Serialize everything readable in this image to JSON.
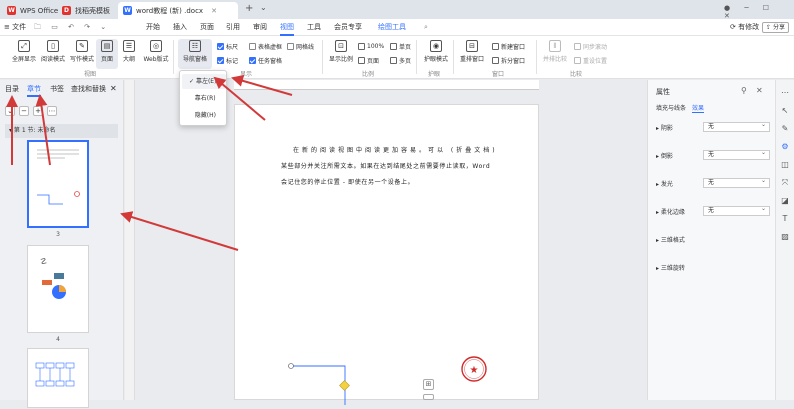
{
  "tabs": [
    {
      "label": "WPS Office",
      "logo": "W"
    },
    {
      "label": "找稻壳模板",
      "logo": "D"
    },
    {
      "label": "word教程 (新) .docx",
      "logo": "W"
    }
  ],
  "titlebar": {
    "right": "● ─ ☐ ✕"
  },
  "menu": {
    "file": "文件",
    "items": [
      "开始",
      "插入",
      "页面",
      "引用",
      "审阅",
      "视图",
      "工具",
      "会员专享"
    ],
    "drawing_tools": "绘图工具",
    "note": "有修改",
    "share": "分享"
  },
  "ribbon": {
    "fullscreen": "全屏显示",
    "read_mode": "阅读模式",
    "write_mode": "写作模式",
    "page_view": "页面",
    "outline": "大纲",
    "web": "Web版式",
    "nav_pane": "导航窗格",
    "ruler": "标尺",
    "table_gridlines": "表格虚框",
    "gridlines": "网格线",
    "markup": "标记",
    "task_pane": "任务窗格",
    "group_views": "视图",
    "group_show": "显示",
    "group_zoom": "比例",
    "group_eye": "护眼",
    "group_window": "窗口",
    "group_compare": "比较",
    "zoom_show": "显示比例",
    "zoom_pct": "100%",
    "one_page": "单页",
    "multi_page": "多页",
    "eye_mode": "护眼模式",
    "rearrange": "重排窗口",
    "new_window": "新建窗口",
    "split_window": "拆分窗口",
    "parallel": "并排比较",
    "sync_scroll": "同步滚动",
    "reset_pos": "重设位置"
  },
  "dropdown": {
    "items": [
      "靠左(E)",
      "靠右(R)",
      "隐藏(H)"
    ]
  },
  "leftnav": {
    "tabs": [
      "目录",
      "章节",
      "书签",
      "查找和替换"
    ],
    "section": "第 1 节: 未命名",
    "pages": [
      "3",
      "4"
    ]
  },
  "doc": {
    "lines": [
      "在新的阅读视图中阅读更加容易。可以 (折叠文档)",
      "某些部分并关注所需文本。如果在达到结尾处之前需要停止读取，Word",
      "会记住您的停止位置 - 即使在另一个设备上。"
    ]
  },
  "rightpanel": {
    "title": "属性",
    "tabs": [
      "填充与线条",
      "效果"
    ],
    "rows": [
      {
        "label": "阴影",
        "value": "无"
      },
      {
        "label": "倒影",
        "value": "无"
      },
      {
        "label": "发光",
        "value": "无"
      },
      {
        "label": "柔化边缘",
        "value": "无"
      },
      {
        "label": "三维格式",
        "value": ""
      },
      {
        "label": "三维旋转",
        "value": ""
      }
    ]
  },
  "colors": {
    "accent": "#3370ff",
    "arrow": "#d23a3a"
  }
}
